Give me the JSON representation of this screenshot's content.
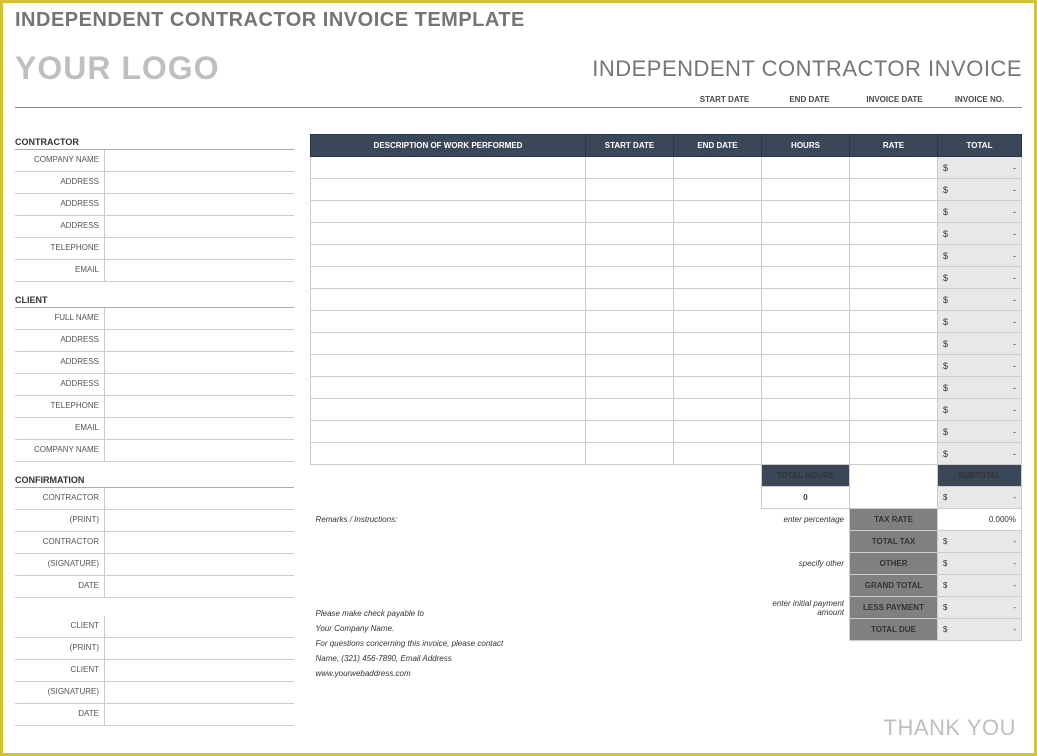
{
  "title": "INDEPENDENT CONTRACTOR INVOICE TEMPLATE",
  "logo": "YOUR LOGO",
  "invoice_title": "INDEPENDENT CONTRACTOR INVOICE",
  "date_headers": {
    "start": "START DATE",
    "end": "END DATE",
    "inv_date": "INVOICE DATE",
    "inv_no": "INVOICE NO."
  },
  "sections": {
    "contractor": "CONTRACTOR",
    "client": "CLIENT",
    "confirmation": "CONFIRMATION"
  },
  "labels": {
    "company_name": "COMPANY NAME",
    "address": "ADDRESS",
    "telephone": "TELEPHONE",
    "email": "EMAIL",
    "full_name": "FULL NAME",
    "contractor": "CONTRACTOR",
    "print": "(PRINT)",
    "signature": "(SIGNATURE)",
    "date": "DATE",
    "client_l": "CLIENT"
  },
  "table": {
    "headers": {
      "desc": "DESCRIPTION OF WORK PERFORMED",
      "start": "START DATE",
      "end": "END DATE",
      "hours": "HOURS",
      "rate": "RATE",
      "total": "TOTAL"
    },
    "dollar": "$",
    "dash": "-"
  },
  "summary": {
    "total_hours": "TOTAL HOURS",
    "subtotal": "SUBTOTAL",
    "zero": "0",
    "enter_pct": "enter percentage",
    "tax_rate": "TAX RATE",
    "pct_val": "0.000%",
    "total_tax": "TOTAL TAX",
    "specify": "specify other",
    "other": "OTHER",
    "grand_total": "GRAND TOTAL",
    "enter_init": "enter initial payment amount",
    "less_payment": "LESS PAYMENT",
    "total_due": "TOTAL DUE"
  },
  "remarks_lbl": "Remarks / Instructions:",
  "payable": {
    "l1": "Please make check payable to",
    "l2": "Your Company Name.",
    "l3": "For questions concerning this invoice, please contact",
    "l4": "Name, (321) 456-7890, Email Address",
    "l5": "www.yourwebaddress.com"
  },
  "thank": "THANK YOU"
}
